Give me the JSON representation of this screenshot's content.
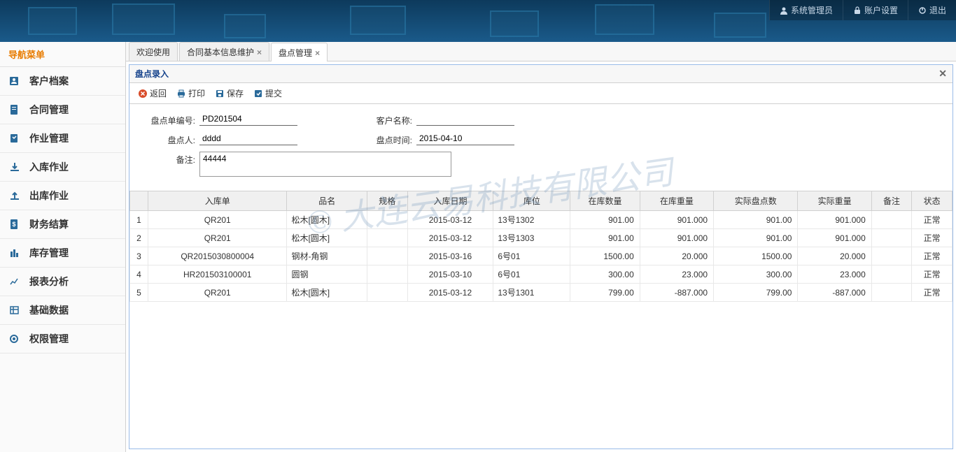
{
  "header": {
    "user_btn": "系统管理员",
    "account_btn": "账户设置",
    "logout_btn": "退出"
  },
  "sidebar": {
    "title": "导航菜单",
    "items": [
      {
        "label": "客户档案"
      },
      {
        "label": "合同管理"
      },
      {
        "label": "作业管理"
      },
      {
        "label": "入库作业"
      },
      {
        "label": "出库作业"
      },
      {
        "label": "财务结算"
      },
      {
        "label": "库存管理"
      },
      {
        "label": "报表分析"
      },
      {
        "label": "基础数据"
      },
      {
        "label": "权限管理"
      }
    ]
  },
  "tabs": [
    {
      "label": "欢迎使用",
      "closable": false
    },
    {
      "label": "合同基本信息维护",
      "closable": true
    },
    {
      "label": "盘点管理",
      "closable": true,
      "active": true
    }
  ],
  "panel": {
    "title": "盘点录入",
    "toolbar": {
      "back": "返回",
      "print": "打印",
      "save": "保存",
      "submit": "提交"
    },
    "form": {
      "code_label": "盘点单编号:",
      "code_value": "PD201504",
      "customer_label": "客户名称:",
      "customer_value": "",
      "person_label": "盘点人:",
      "person_value": "dddd",
      "time_label": "盘点时间:",
      "time_value": "2015-04-10",
      "remark_label": "备注:",
      "remark_value": "44444"
    },
    "grid": {
      "columns": [
        "",
        "入库单",
        "品名",
        "规格",
        "入库日期",
        "库位",
        "在库数量",
        "在库重量",
        "实际盘点数",
        "实际重量",
        "备注",
        "状态"
      ],
      "rows": [
        {
          "n": "1",
          "inNo": "QR201",
          "name": "松木[圆木]",
          "spec": "",
          "date": "2015-03-12",
          "loc": "13号1302",
          "qty": "901.00",
          "wt": "901.000",
          "actQty": "901.00",
          "actWt": "901.000",
          "remark": "",
          "status": "正常"
        },
        {
          "n": "2",
          "inNo": "QR201",
          "name": "松木[圆木]",
          "spec": "",
          "date": "2015-03-12",
          "loc": "13号1303",
          "qty": "901.00",
          "wt": "901.000",
          "actQty": "901.00",
          "actWt": "901.000",
          "remark": "",
          "status": "正常"
        },
        {
          "n": "3",
          "inNo": "QR2015030800004",
          "name": "钢材-角钢",
          "spec": "",
          "date": "2015-03-16",
          "loc": "6号01",
          "qty": "1500.00",
          "wt": "20.000",
          "actQty": "1500.00",
          "actWt": "20.000",
          "remark": "",
          "status": "正常"
        },
        {
          "n": "4",
          "inNo": "HR201503100001",
          "name": "圆钢",
          "spec": "",
          "date": "2015-03-10",
          "loc": "6号01",
          "qty": "300.00",
          "wt": "23.000",
          "actQty": "300.00",
          "actWt": "23.000",
          "remark": "",
          "status": "正常"
        },
        {
          "n": "5",
          "inNo": "QR201",
          "name": "松木[圆木]",
          "spec": "",
          "date": "2015-03-12",
          "loc": "13号1301",
          "qty": "799.00",
          "wt": "-887.000",
          "actQty": "799.00",
          "actWt": "-887.000",
          "remark": "",
          "status": "正常"
        }
      ]
    }
  },
  "watermark": "© 大连云易科技有限公司"
}
